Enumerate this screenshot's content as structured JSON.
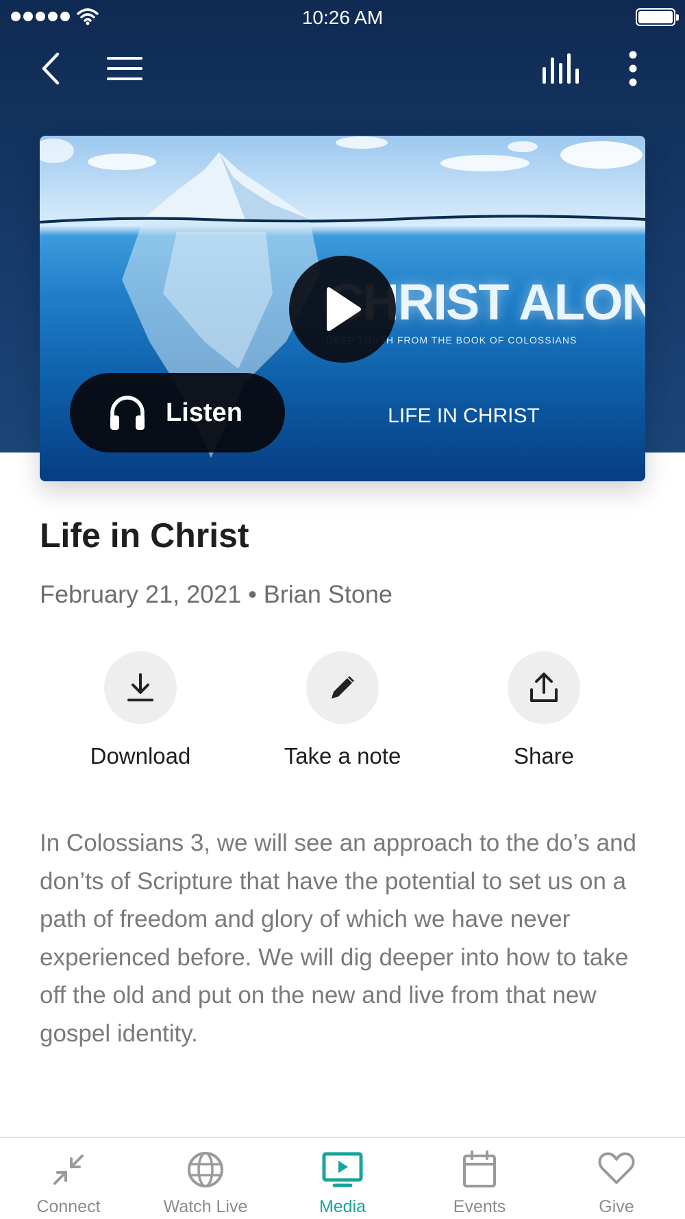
{
  "status_bar": {
    "time": "10:26 AM"
  },
  "top_nav": {
    "back_icon": "chevron-left-icon",
    "menu_icon": "hamburger-menu-icon",
    "audio_icon": "audio-bars-icon",
    "more_icon": "vertical-ellipsis-icon"
  },
  "media": {
    "series_title": "CHRIST ALONE",
    "series_subtitle": "DEEP TRUTH FROM THE BOOK OF COLOSSIANS",
    "sermon_tag": "LIFE IN CHRIST",
    "listen_label": "Listen",
    "play_icon": "play-icon",
    "listen_icon": "headphones-icon"
  },
  "sermon": {
    "title": "Life in Christ",
    "meta": "February 21, 2021 • Brian Stone",
    "description": "In Colossians 3, we will see an approach to the do’s and don’ts of Scripture that have the potential to set us on a path of freedom and glory of which we have never experienced before. We will dig deeper into how to take off the old and put on the new and live from that new gospel identity."
  },
  "actions": [
    {
      "label": "Download",
      "icon": "download-icon"
    },
    {
      "label": "Take a note",
      "icon": "pencil-icon"
    },
    {
      "label": "Share",
      "icon": "share-icon"
    }
  ],
  "tabs": [
    {
      "label": "Connect",
      "icon": "connect-icon",
      "active": false
    },
    {
      "label": "Watch Live",
      "icon": "globe-icon",
      "active": false
    },
    {
      "label": "Media",
      "icon": "tv-play-icon",
      "active": true
    },
    {
      "label": "Events",
      "icon": "calendar-icon",
      "active": false
    },
    {
      "label": "Give",
      "icon": "heart-icon",
      "active": false
    }
  ],
  "colors": {
    "header_navy": "#163a6a",
    "accent_teal": "#1aa39b",
    "inactive_gray": "#8c8c8c",
    "text_dark": "#1e1e1e",
    "text_muted": "#7a7a7a"
  }
}
